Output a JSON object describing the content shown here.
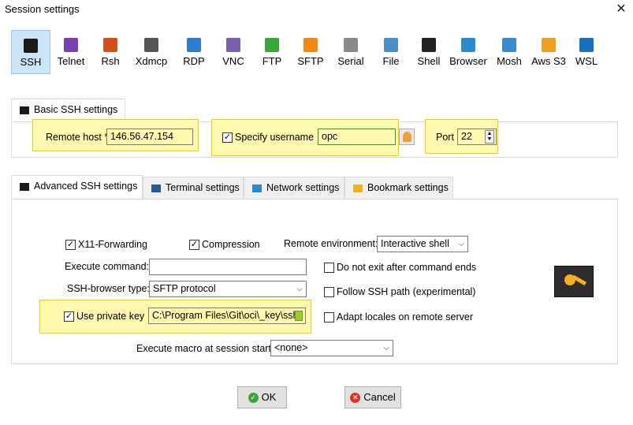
{
  "window": {
    "title": "Session settings",
    "close_glyph": "✕"
  },
  "session_types": [
    {
      "label": "SSH",
      "icon": "ssh-icon",
      "color": "#1a1a1a",
      "selected": true
    },
    {
      "label": "Telnet",
      "icon": "telnet-icon",
      "color": "#7a3fb0"
    },
    {
      "label": "Rsh",
      "icon": "rsh-icon",
      "color": "#d4501a"
    },
    {
      "label": "Xdmcp",
      "icon": "xdmcp-icon",
      "color": "#555555"
    },
    {
      "label": "RDP",
      "icon": "rdp-icon",
      "color": "#2f7bd0"
    },
    {
      "label": "VNC",
      "icon": "vnc-icon",
      "color": "#7a5fb0"
    },
    {
      "label": "FTP",
      "icon": "ftp-icon",
      "color": "#3aa53a"
    },
    {
      "label": "SFTP",
      "icon": "sftp-icon",
      "color": "#f08a12"
    },
    {
      "label": "Serial",
      "icon": "serial-icon",
      "color": "#8a8a8a"
    },
    {
      "label": "File",
      "icon": "file-icon",
      "color": "#4a90c8"
    },
    {
      "label": "Shell",
      "icon": "shell-icon",
      "color": "#222222"
    },
    {
      "label": "Browser",
      "icon": "browser-icon",
      "color": "#2a8ad0"
    },
    {
      "label": "Mosh",
      "icon": "mosh-icon",
      "color": "#3a8ad0"
    },
    {
      "label": "Aws S3",
      "icon": "aws-s3-icon",
      "color": "#f0a020"
    },
    {
      "label": "WSL",
      "icon": "wsl-icon",
      "color": "#1a6fc0"
    }
  ],
  "basic": {
    "tab_label": "Basic SSH settings",
    "remote_host_label": "Remote host *",
    "remote_host_value": "146.56.47.154",
    "specify_username_label": "Specify username",
    "specify_username_checked": true,
    "username_value": "opc",
    "port_label": "Port",
    "port_value": "22"
  },
  "tabs": [
    {
      "label": "Advanced SSH settings",
      "icon": "advanced-ssh-icon",
      "active": true
    },
    {
      "label": "Terminal settings",
      "icon": "terminal-icon"
    },
    {
      "label": "Network settings",
      "icon": "network-icon"
    },
    {
      "label": "Bookmark settings",
      "icon": "star-icon"
    }
  ],
  "advanced": {
    "x11_label": "X11-Forwarding",
    "compression_label": "Compression",
    "remote_env_label": "Remote environment:",
    "remote_env_value": "Interactive shell",
    "execute_command_label": "Execute command:",
    "execute_command_value": "",
    "no_exit_label": "Do not exit after command ends",
    "browser_type_label": "SSH-browser type:",
    "browser_type_value": "SFTP protocol",
    "follow_path_label": "Follow SSH path (experimental)",
    "private_key_label": "Use private key",
    "private_key_value": "C:\\Program Files\\Git\\oci\\_key\\ssh-",
    "adapt_locales_label": "Adapt locales on remote server",
    "macro_label": "Execute macro at session start:",
    "macro_value": "<none>",
    "check_glyph": "✓"
  },
  "buttons": {
    "ok": "OK",
    "cancel": "Cancel"
  },
  "colors": {
    "highlight": "#fff9b0",
    "highlight_border": "#e8d400",
    "selection": "#cce4f7",
    "ok_icon": "#3aa53a",
    "cancel_icon": "#d8342c"
  }
}
